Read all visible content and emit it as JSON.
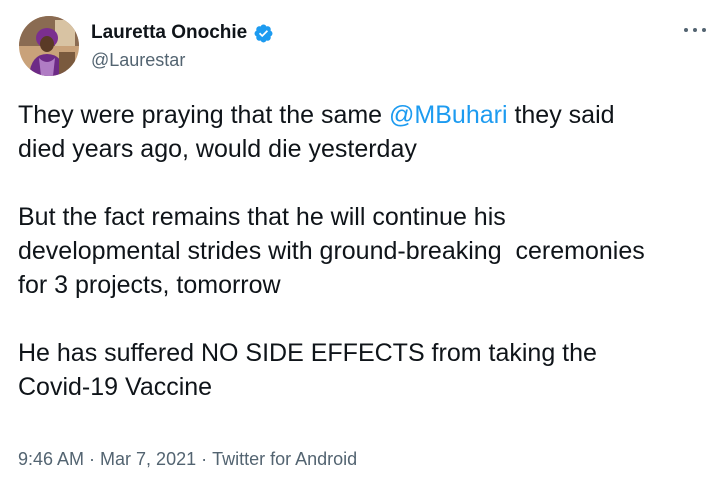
{
  "tweet": {
    "author": {
      "display_name": "Lauretta Onochie",
      "handle": "@Laurestar",
      "verified": true
    },
    "paragraph1": {
      "before": "They were praying that the same ",
      "mention": "@MBuhari",
      "after": " they said\ndied years ago, would die yesterday"
    },
    "paragraph2": "But the fact remains that he will continue his\ndevelopmental strides with ground-breaking  ceremonies\nfor 3 projects, tomorrow",
    "paragraph3": "He has suffered NO SIDE EFFECTS from taking the\nCovid-19 Vaccine",
    "meta": {
      "time": "9:46 AM",
      "separator": "·",
      "date": "Mar 7, 2021",
      "source": "Twitter for Android"
    }
  },
  "icons": {
    "verified": "verified-badge-icon",
    "more": "more-options-icon"
  },
  "colors": {
    "link": "#1d9bf0",
    "secondary_text": "#536471",
    "primary_text": "#0f1419"
  }
}
